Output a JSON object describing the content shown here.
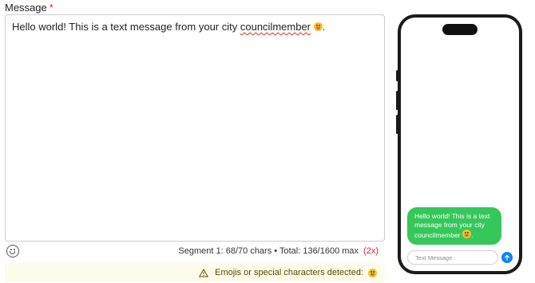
{
  "form": {
    "label": "Message",
    "required_mark": "*",
    "message_prefix": "Hello world! This is a text message from your city ",
    "message_misspelled_word": "councilmember",
    "message_suffix": "."
  },
  "footer": {
    "emoji_button_icon": "smiley-icon",
    "segment_info": "Segment 1: 68/70 chars • Total: 136/1600 max",
    "segment_multiplier": "(2x)"
  },
  "warning": {
    "icon": "warning-triangle-icon",
    "text": "Emojis or special characters detected:"
  },
  "phone_preview": {
    "bubble_text": "Hello world! This is a text message from your city councilmember",
    "bubble_color": "#35c759",
    "compose_placeholder": "Text Message",
    "send_icon": "arrow-up-icon",
    "send_color": "#0a84ff"
  }
}
